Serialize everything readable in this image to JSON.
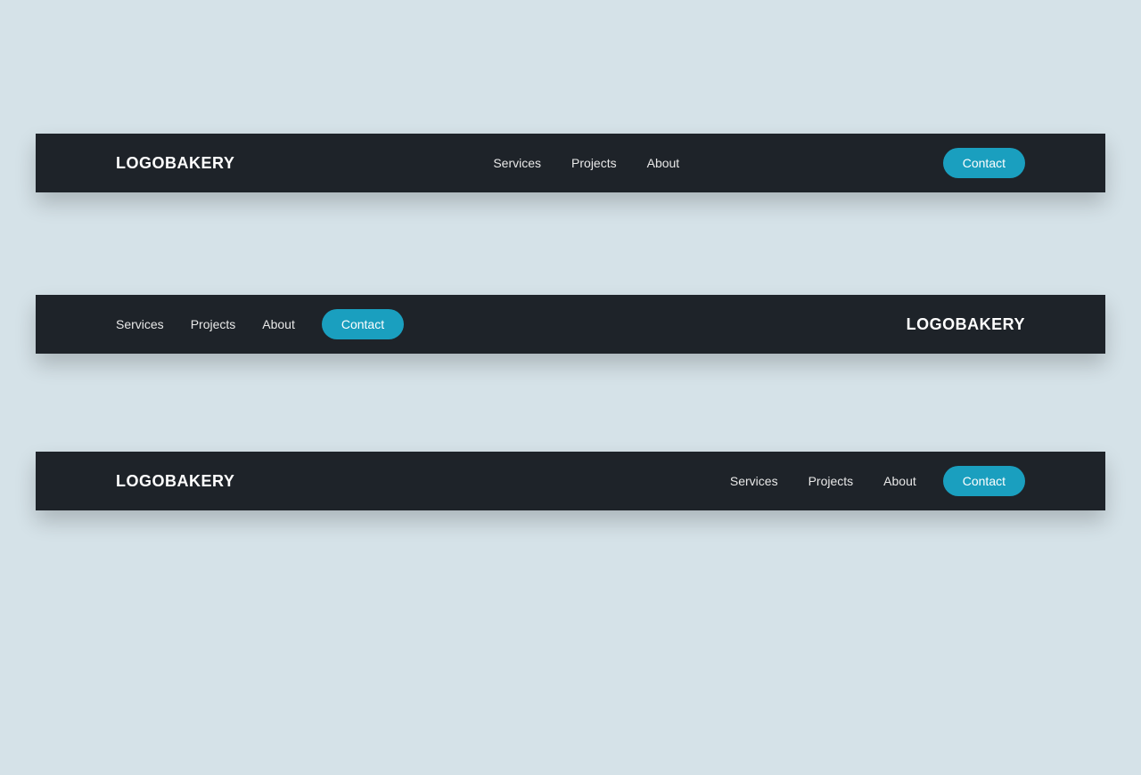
{
  "brand": "LOGOBAKERY",
  "nav": {
    "services": "Services",
    "projects": "Projects",
    "about": "About",
    "contact": "Contact"
  }
}
